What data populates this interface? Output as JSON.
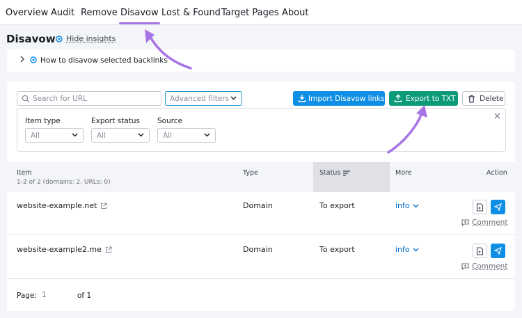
{
  "nav": {
    "tabs": [
      {
        "label": "Overview"
      },
      {
        "label": "Audit"
      },
      {
        "label": "Remove"
      },
      {
        "label": "Disavow",
        "active": true
      },
      {
        "label": "Lost & Found"
      },
      {
        "label": "Target Pages"
      },
      {
        "label": "About"
      }
    ]
  },
  "header": {
    "title": "Disavow",
    "hide_insights": "Hide insights"
  },
  "insight": {
    "text": "How to disavow selected backlinks"
  },
  "toolbar": {
    "search_placeholder": "Search for URL",
    "advanced_filters": "Advanced filters",
    "import_label": "Import Disavow links",
    "export_label": "Export to TXT",
    "delete_label": "Delete"
  },
  "filters": [
    {
      "label": "Item type",
      "value": "All"
    },
    {
      "label": "Export status",
      "value": "All"
    },
    {
      "label": "Source",
      "value": "All"
    }
  ],
  "table": {
    "columns": {
      "item": "Item",
      "item_sub": "1-2 of 2 (domains: 2, URLs: 0)",
      "type": "Type",
      "status": "Status",
      "more": "More",
      "action": "Action"
    },
    "rows": [
      {
        "item": "website-example.net",
        "type": "Domain",
        "status": "To export",
        "more": "info",
        "comment": "Comment"
      },
      {
        "item": "website-example2.me",
        "type": "Domain",
        "status": "To export",
        "more": "info",
        "comment": "Comment"
      }
    ]
  },
  "pager": {
    "label": "Page:",
    "current": "1",
    "of": "of 1"
  },
  "colors": {
    "accent_purple": "#a774e6",
    "import_blue": "#0e8ee5",
    "export_green": "#0b9a7a",
    "link_blue": "#006dca"
  },
  "icons": {
    "settings": "gear-icon",
    "search": "search-icon",
    "download": "download-icon",
    "upload": "upload-icon",
    "trash": "trash-icon",
    "external": "external-link-icon",
    "note": "note-icon",
    "send": "send-icon",
    "comment": "comment-icon",
    "close": "close-icon",
    "chevron": "chevron-down-icon"
  }
}
